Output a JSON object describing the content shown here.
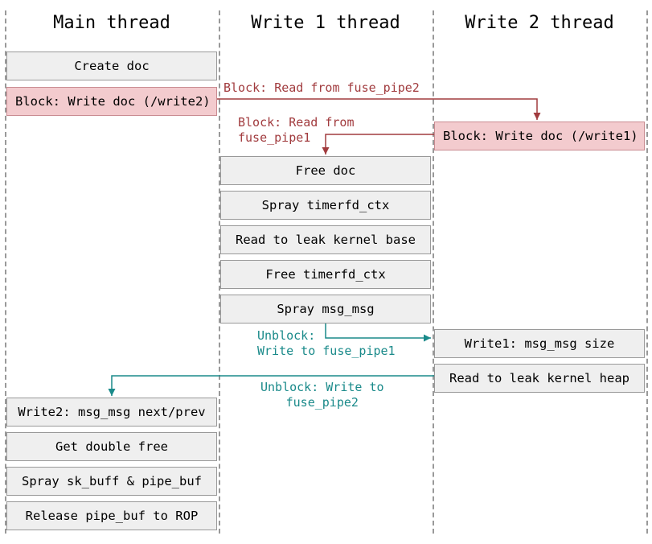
{
  "columns": {
    "c1": "Main thread",
    "c2": "Write 1 thread",
    "c3": "Write 2 thread"
  },
  "blocks": {
    "createDoc": "Create doc",
    "blockWrite2": "Block: Write doc (/write2)",
    "blockWrite1": "Block: Write doc (/write1)",
    "freeDoc": "Free doc",
    "sprayTimerfd": "Spray timerfd_ctx",
    "readKernelBase": "Read to leak kernel base",
    "freeTimerfd": "Free timerfd_ctx",
    "sprayMsg": "Spray msg_msg",
    "write1MsgSize": "Write1: msg_msg size",
    "readKernelHeap": "Read to leak kernel heap",
    "write2MsgNextPrev": "Write2: msg_msg next/prev",
    "doubleFree": "Get double free",
    "spraySkPipe": "Spray sk_buff & pipe_buf",
    "releasePipeRop": "Release pipe_buf to ROP"
  },
  "arrows": {
    "blockRead2": "Block: Read from fuse_pipe2",
    "blockRead1a": "Block: Read from",
    "blockRead1b": "fuse_pipe1",
    "unblock1a": "Unblock:",
    "unblock1b": "Write to fuse_pipe1",
    "unblock2a": "Unblock: Write to",
    "unblock2b": "fuse_pipe2"
  },
  "chart_data": {
    "type": "sequence-diagram",
    "threads": [
      "Main thread",
      "Write 1 thread",
      "Write 2 thread"
    ],
    "steps": [
      {
        "thread": "Main thread",
        "action": "Create doc",
        "blocking": false
      },
      {
        "thread": "Main thread",
        "action": "Block: Write doc (/write2)",
        "blocking": true,
        "signal_to": "Write 2 thread",
        "signal_label": "Block: Read from fuse_pipe2"
      },
      {
        "thread": "Write 2 thread",
        "action": "Block: Write doc (/write1)",
        "blocking": true,
        "signal_to": "Write 1 thread",
        "signal_label": "Block: Read from fuse_pipe1"
      },
      {
        "thread": "Write 1 thread",
        "action": "Free doc",
        "blocking": false
      },
      {
        "thread": "Write 1 thread",
        "action": "Spray timerfd_ctx",
        "blocking": false
      },
      {
        "thread": "Write 1 thread",
        "action": "Read to leak kernel base",
        "blocking": false
      },
      {
        "thread": "Write 1 thread",
        "action": "Free timerfd_ctx",
        "blocking": false
      },
      {
        "thread": "Write 1 thread",
        "action": "Spray msg_msg",
        "blocking": false,
        "signal_to": "Write 2 thread",
        "signal_label": "Unblock: Write to fuse_pipe1"
      },
      {
        "thread": "Write 2 thread",
        "action": "Write1: msg_msg size",
        "blocking": false
      },
      {
        "thread": "Write 2 thread",
        "action": "Read to leak kernel heap",
        "blocking": false,
        "signal_to": "Main thread",
        "signal_label": "Unblock: Write to fuse_pipe2"
      },
      {
        "thread": "Main thread",
        "action": "Write2: msg_msg next/prev",
        "blocking": false
      },
      {
        "thread": "Main thread",
        "action": "Get double free",
        "blocking": false
      },
      {
        "thread": "Main thread",
        "action": "Spray sk_buff & pipe_buf",
        "blocking": false
      },
      {
        "thread": "Main thread",
        "action": "Release pipe_buf to ROP",
        "blocking": false
      }
    ]
  }
}
